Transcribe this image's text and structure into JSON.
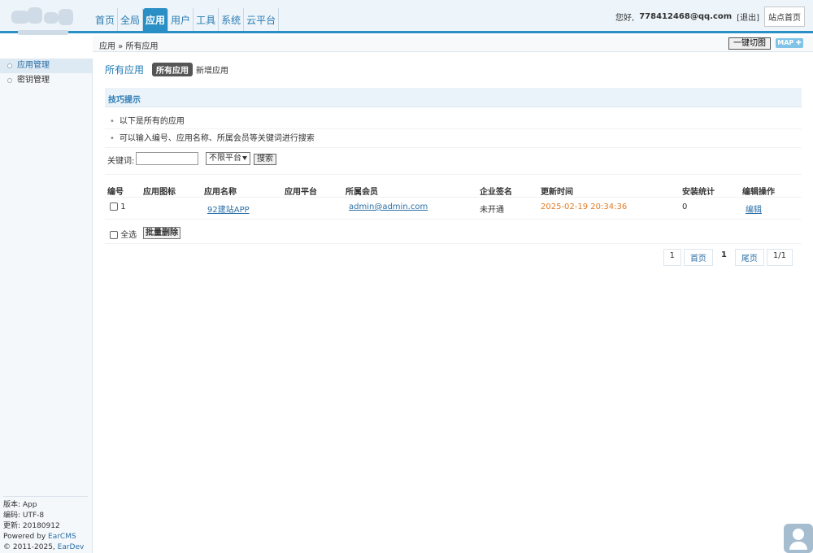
{
  "header": {
    "nav": [
      "首页",
      "全局",
      "应用",
      "用户",
      "工具",
      "系统",
      "云平台"
    ],
    "active_nav_index": 2,
    "greeting": "您好,",
    "user_email": "778412468@qq.com",
    "logout_label": "[退出]",
    "home_label": "站点首页"
  },
  "subbar": {
    "breadcrumb": "应用 » 所有应用",
    "cut_label": "一键切图",
    "map_label": "MAP ✚"
  },
  "sidebar": {
    "items": [
      {
        "label": "应用管理",
        "active": true
      },
      {
        "label": "密钥管理",
        "active": false
      }
    ],
    "footer": {
      "version": "版本: App",
      "encoding": "编码: UTF-8",
      "updated": "更新: 20180912",
      "powered_prefix": "Powered by ",
      "powered_link": "EarCMS",
      "copyright_prefix": "© 2011-2025, ",
      "copyright_link": "EarDev Inc."
    }
  },
  "main": {
    "title": "所有应用",
    "tab_all": "所有应用",
    "tab_new": "新增应用",
    "tips_title": "技巧提示",
    "tips": [
      "以下是所有的应用",
      "可以输入编号、应用名称、所属会员等关键词进行搜索"
    ],
    "search": {
      "label": "关键词:",
      "value": "",
      "platform_selected": "不限平台",
      "button": "搜索"
    },
    "table": {
      "headers": [
        "编号",
        "应用图标",
        "应用名称",
        "应用平台",
        "所属会员",
        "企业签名",
        "更新时间",
        "安装统计",
        "编辑操作"
      ],
      "rows": [
        {
          "id": "1",
          "icon": "",
          "name": "92建站APP",
          "platform": "",
          "member": "admin@admin.com",
          "signature": "未开通",
          "updated": "2025-02-19 20:34:36",
          "installs": "0",
          "action": "编辑"
        }
      ]
    },
    "select_all_label": "全选",
    "batch_delete_label": "批量删除",
    "pager": {
      "total": "1",
      "first": "首页",
      "current": "1",
      "last": "尾页",
      "pages": "1/1"
    }
  },
  "colors": {
    "accent": "#2a8fc4",
    "link": "#2b6fa6",
    "time": "#e57c24"
  }
}
